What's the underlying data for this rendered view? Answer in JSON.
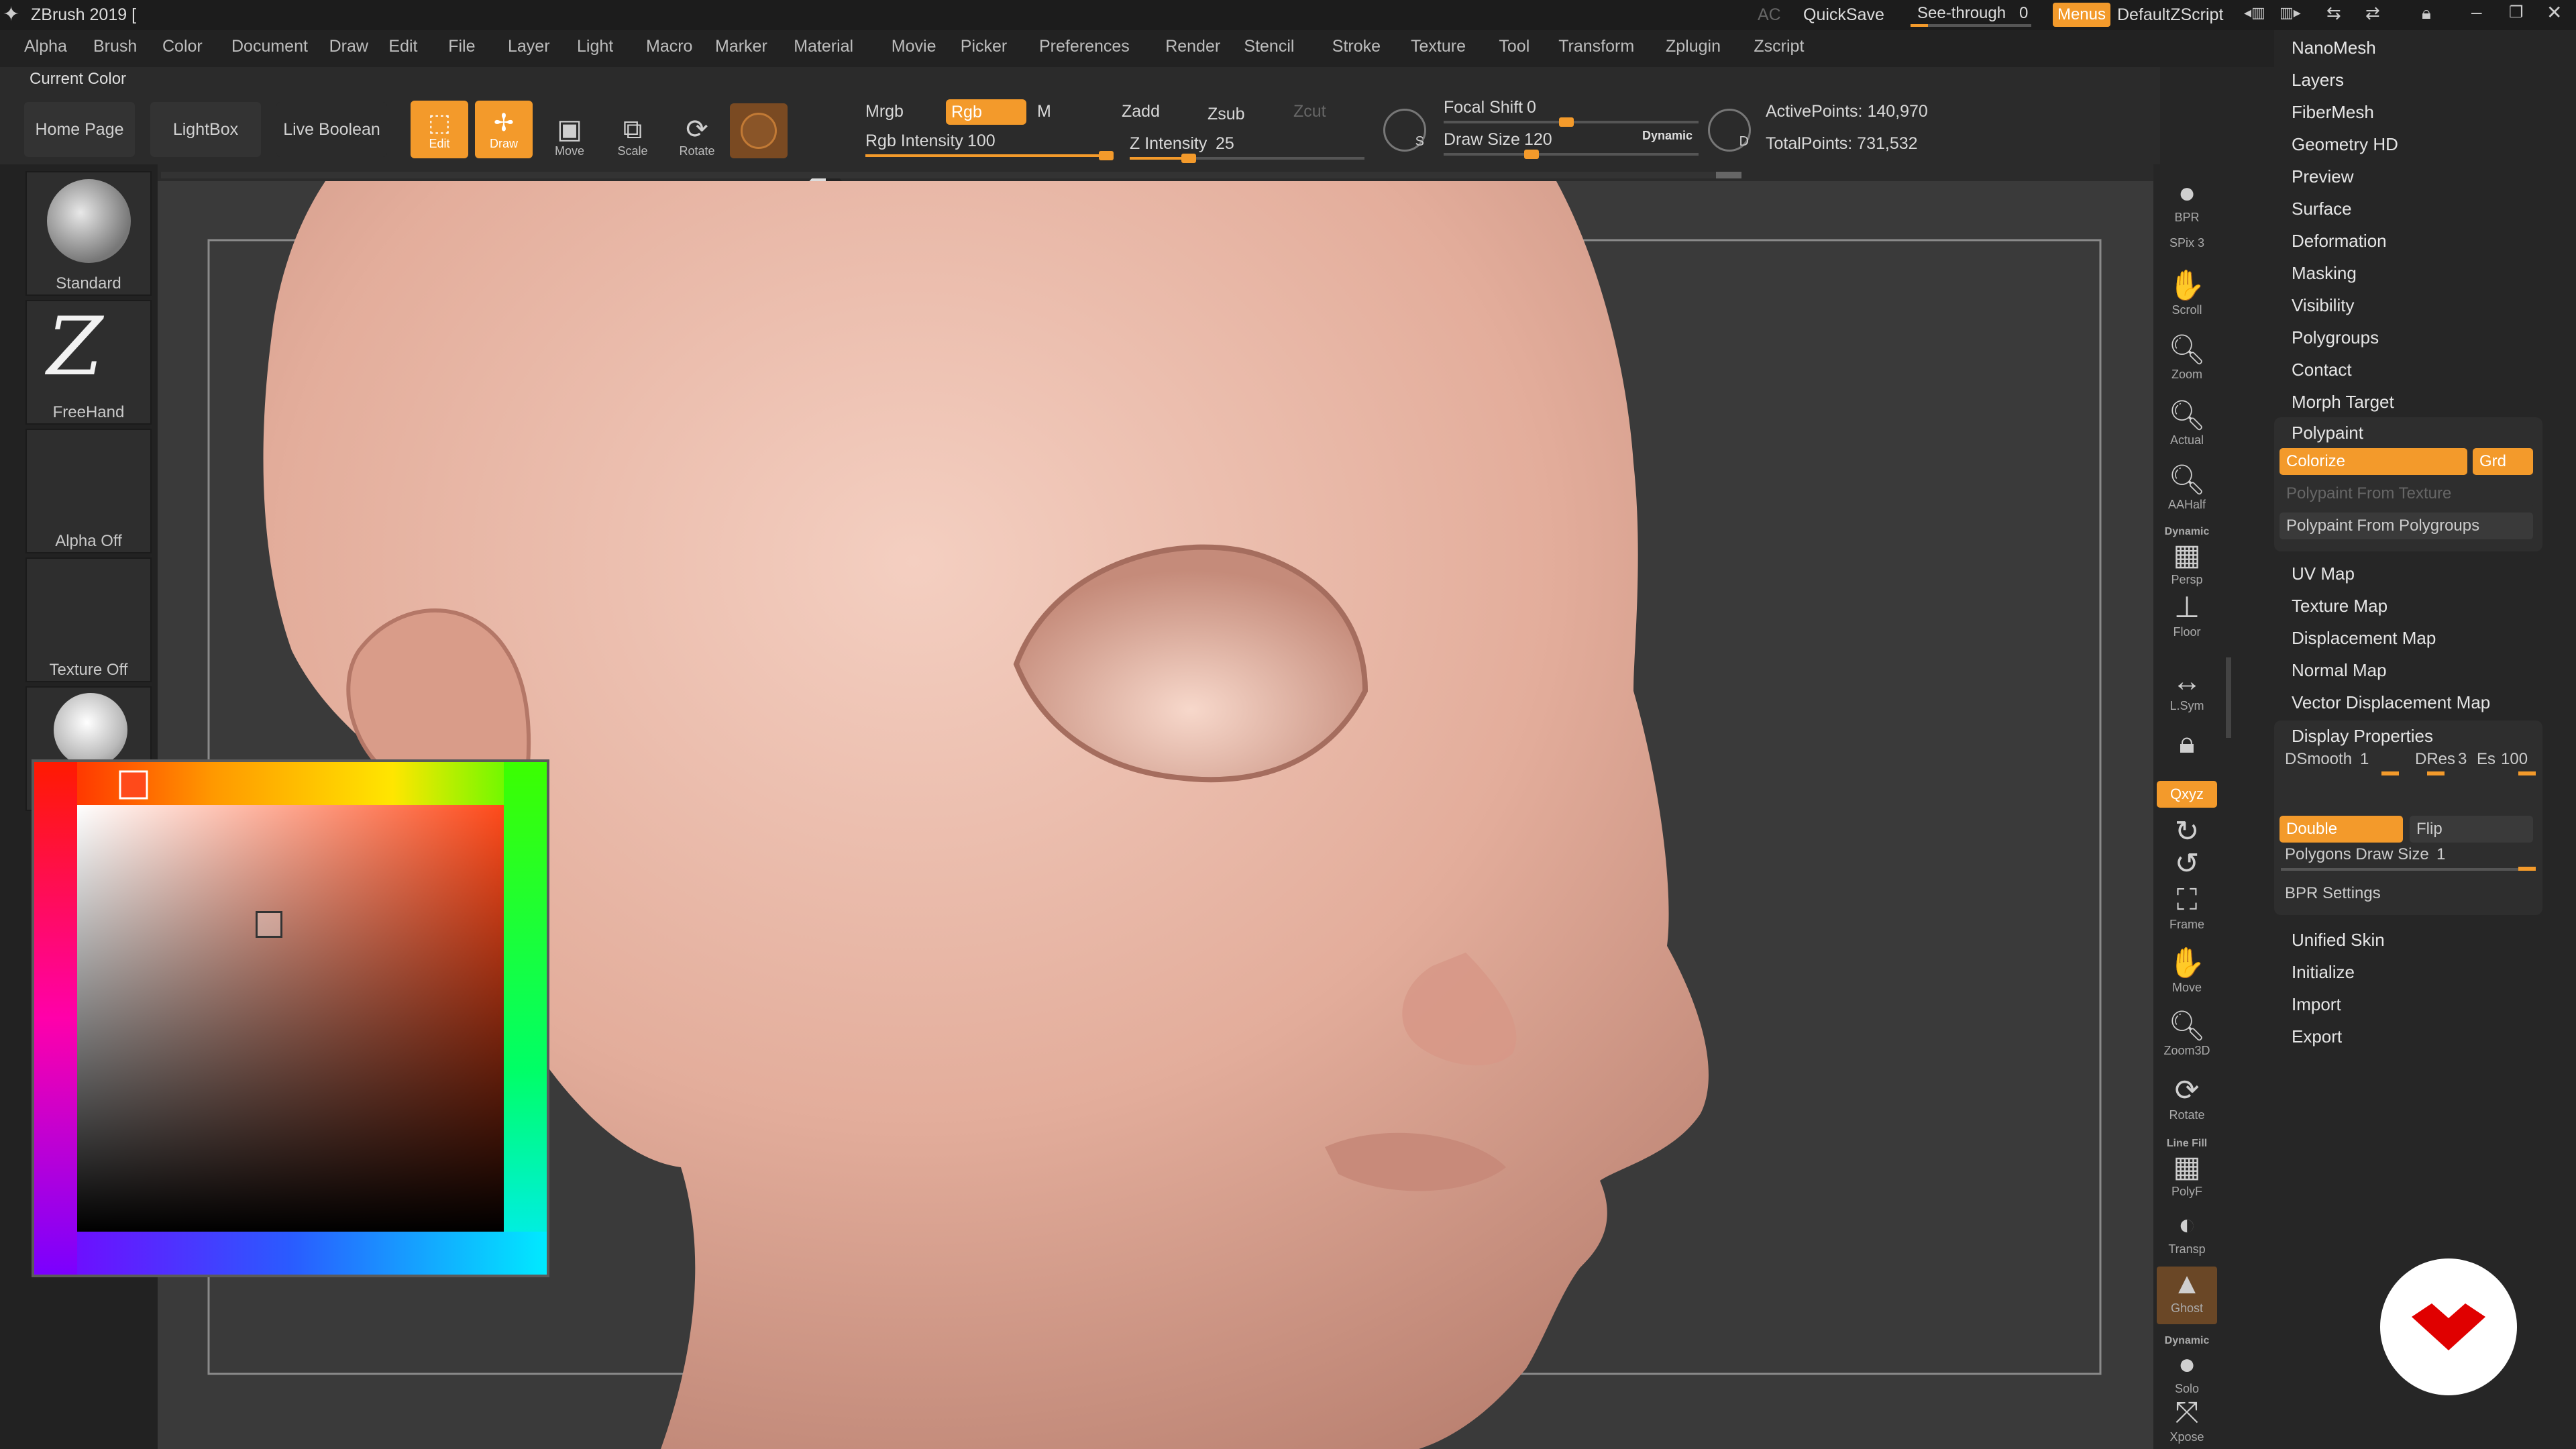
{
  "window": {
    "title": "ZBrush 2019 ["
  },
  "title_right": {
    "ac": "AC",
    "quicksave": "QuickSave",
    "see_through_label": "See-through",
    "see_through_value": "0",
    "menus": "Menus",
    "script": "DefaultZScript"
  },
  "menus": [
    "Alpha",
    "Brush",
    "Color",
    "Document",
    "Draw",
    "Edit",
    "File",
    "Layer",
    "Light",
    "Macro",
    "Marker",
    "Material",
    "Movie",
    "Picker",
    "Preferences",
    "Render",
    "Stencil",
    "Stroke",
    "Texture",
    "Tool",
    "Transform",
    "Zplugin",
    "Zscript"
  ],
  "current_color_label": "Current Color",
  "toolbar": {
    "home_page": "Home Page",
    "lightbox": "LightBox",
    "live_boolean": "Live Boolean",
    "edit": "Edit",
    "draw": "Draw",
    "move": "Move",
    "scale": "Scale",
    "rotate": "Rotate",
    "mrgb": "Mrgb",
    "rgb": "Rgb",
    "m": "M",
    "zadd": "Zadd",
    "zsub": "Zsub",
    "zcut": "Zcut",
    "rgb_intensity_label": "Rgb Intensity",
    "rgb_intensity_value": "100",
    "rgb_intensity_level": 1.0,
    "z_intensity_label": "Z Intensity",
    "z_intensity_value": "25",
    "z_intensity_level": 0.25,
    "focal_shift_label": "Focal Shift",
    "focal_shift_value": "0",
    "draw_size_label": "Draw Size",
    "draw_size_value": "120",
    "dynamic": "Dynamic",
    "active_points": "ActivePoints: 140,970",
    "total_points": "TotalPoints: 731,532"
  },
  "left_shelf": [
    {
      "label": "Standard",
      "icon": "standard-brush-icon"
    },
    {
      "label": "FreeHand",
      "icon": "freehand-stroke-icon"
    },
    {
      "label": "Alpha Off",
      "icon": "alpha-icon"
    },
    {
      "label": "Texture Off",
      "icon": "texture-icon"
    }
  ],
  "color_picker": {
    "selected_hue": "#ff4a1a",
    "saturation_pick": 0.45,
    "value_pick": 0.72
  },
  "right_shelf": [
    {
      "label": "BPR",
      "icon": "bpr-render-icon"
    },
    {
      "label": "SPix 3",
      "icon": "spix-icon"
    },
    {
      "label": "Scroll",
      "icon": "scroll-hand-icon"
    },
    {
      "label": "Zoom",
      "icon": "zoom-icon"
    },
    {
      "label": "Actual",
      "icon": "actual-size-icon"
    },
    {
      "label": "AAHalf",
      "icon": "aahalf-icon"
    },
    {
      "label": "Persp",
      "icon": "perspective-icon",
      "top_label": "Dynamic"
    },
    {
      "label": "Floor",
      "icon": "floor-grid-icon"
    },
    {
      "label": "L.Sym",
      "icon": "local-symmetry-icon"
    },
    {
      "label": "",
      "icon": "lock-icon"
    },
    {
      "label": "Qxyz",
      "icon": "xyz-rotate-icon"
    },
    {
      "label": "",
      "icon": "rotate-y-icon"
    },
    {
      "label": "",
      "icon": "rotate-z-icon"
    },
    {
      "label": "Frame",
      "icon": "frame-icon"
    },
    {
      "label": "Move",
      "icon": "move-hand-icon"
    },
    {
      "label": "Zoom3D",
      "icon": "zoom3d-icon"
    },
    {
      "label": "Rotate",
      "icon": "rotate-icon"
    },
    {
      "label": "PolyF",
      "icon": "polyframe-icon",
      "top_label": "Line Fill"
    },
    {
      "label": "Transp",
      "icon": "transparency-icon"
    },
    {
      "label": "Ghost",
      "icon": "ghost-icon"
    },
    {
      "label": "Solo",
      "icon": "solo-icon",
      "top_label": "Dynamic"
    },
    {
      "label": "Xpose",
      "icon": "xpose-icon"
    }
  ],
  "right_panel": {
    "items_top": [
      "NanoMesh",
      "Layers",
      "FiberMesh",
      "Geometry HD",
      "Preview",
      "Surface",
      "Deformation",
      "Masking",
      "Visibility",
      "Polygroups",
      "Contact",
      "Morph Target"
    ],
    "polypaint": {
      "title": "Polypaint",
      "colorize": "Colorize",
      "grd": "Grd",
      "from_texture": "Polypaint From Texture",
      "from_polygroups": "Polypaint From Polygroups"
    },
    "items_mid": [
      "UV Map",
      "Texture Map",
      "Displacement Map",
      "Normal Map",
      "Vector Displacement Map"
    ],
    "display_properties": {
      "title": "Display Properties",
      "dsmooth_label": "DSmooth",
      "dsmooth_value": "1",
      "dres_label": "DRes",
      "dres_value": "3",
      "es_label": "Es",
      "es_value": "100",
      "double": "Double",
      "flip": "Flip",
      "poly_draw_size_label": "Polygons Draw Size",
      "poly_draw_size_value": "1",
      "bpr_settings": "BPR Settings"
    },
    "items_bottom": [
      "Unified Skin",
      "Initialize",
      "Import",
      "Export"
    ]
  },
  "brand_badge": {
    "color": "#e00000"
  }
}
